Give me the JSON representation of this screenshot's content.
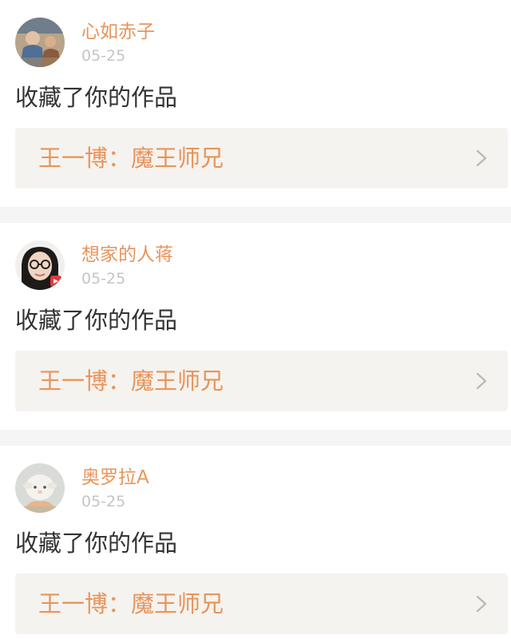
{
  "feed": {
    "items": [
      {
        "username": "心如赤子",
        "date": "05-25",
        "action": "收藏了你的作品",
        "work_title": "王一博：魔王师兄",
        "avatar_icon": "avatar-photo-people"
      },
      {
        "username": "想家的人蒋",
        "date": "05-25",
        "action": "收藏了你的作品",
        "work_title": "王一博：魔王师兄",
        "avatar_icon": "avatar-photo-woman-glasses"
      },
      {
        "username": "奥罗拉A",
        "date": "05-25",
        "action": "收藏了你的作品",
        "work_title": "王一博：魔王师兄",
        "avatar_icon": "avatar-photo-plush-lamb"
      }
    ]
  },
  "colors": {
    "accent": "#e8945a",
    "date_gray": "#c5c5c5",
    "text_dark": "#333333",
    "link_bg": "#f5f3ef",
    "separator": "#f5f5f5"
  }
}
